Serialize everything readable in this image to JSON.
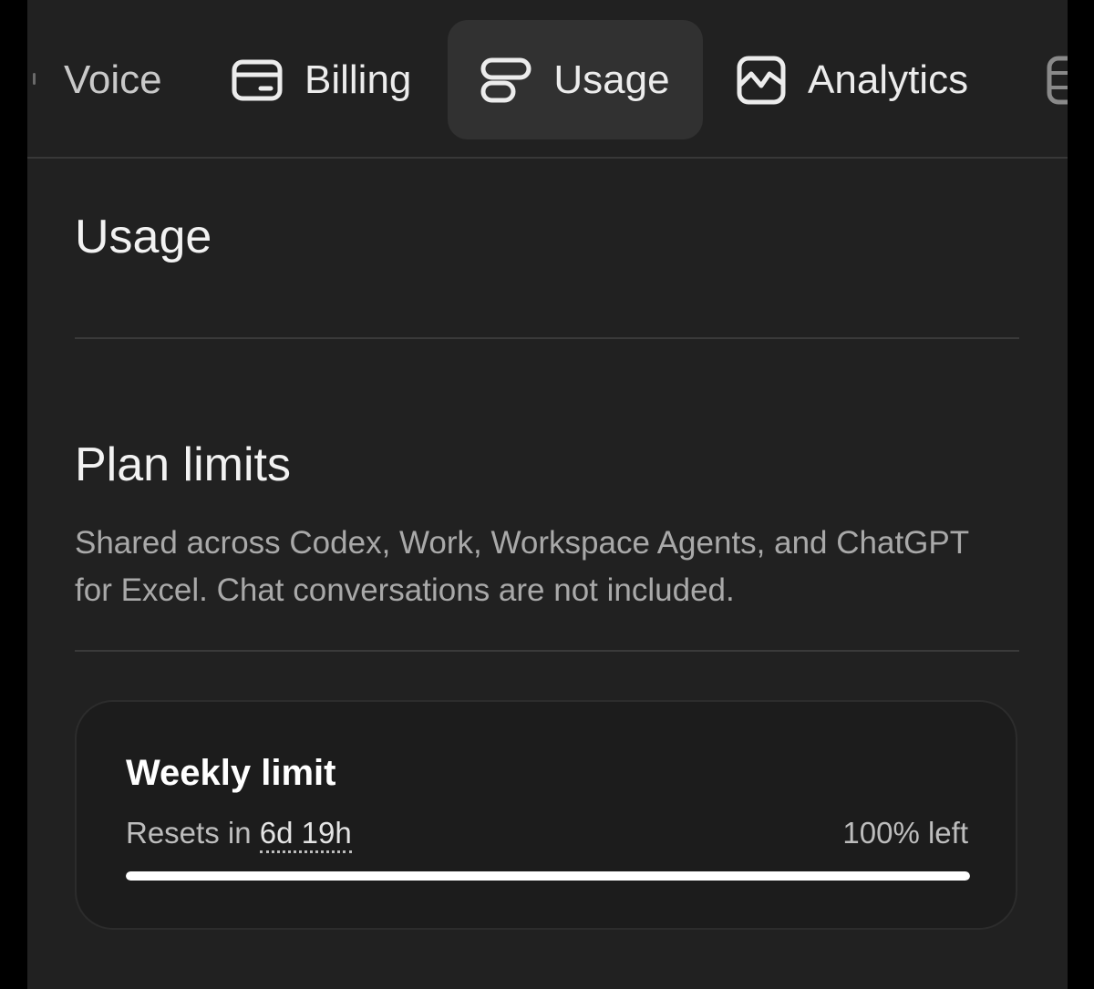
{
  "tabs": [
    {
      "label": "Voice",
      "icon": "voice-icon",
      "active": false
    },
    {
      "label": "Billing",
      "icon": "credit-card-icon",
      "active": false
    },
    {
      "label": "Usage",
      "icon": "usage-bars-icon",
      "active": true
    },
    {
      "label": "Analytics",
      "icon": "chart-line-icon",
      "active": false
    }
  ],
  "page": {
    "title": "Usage"
  },
  "plan_limits": {
    "title": "Plan limits",
    "description": "Shared across Codex, Work, Workspace Agents, and ChatGPT for Excel. Chat conversations are not included."
  },
  "weekly_limit": {
    "title": "Weekly limit",
    "resets_prefix": "Resets in",
    "resets_value": "6d 19h",
    "remaining_label": "100% left",
    "remaining_fraction": 1.0
  },
  "colors": {
    "background": "#212121",
    "active_tab": "#313131",
    "progress_fill": "#ffffff"
  }
}
